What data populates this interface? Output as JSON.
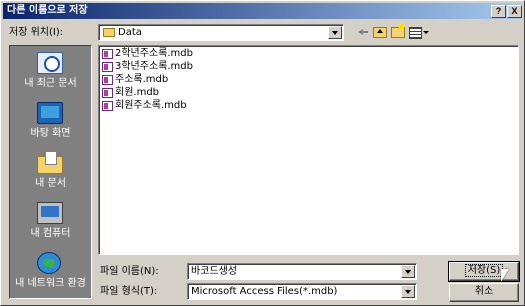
{
  "window": {
    "title": "다른 이름으로 저장",
    "help_button": "?",
    "close_button": "X"
  },
  "location": {
    "label": "저장 위치(I):",
    "value": "Data",
    "icon": "folder-icon"
  },
  "toolbar": {
    "icons": [
      "back-icon",
      "up-folder-icon",
      "new-folder-icon",
      "views-menu-icon"
    ]
  },
  "places": [
    {
      "label": "내 최근 문서",
      "icon": "recent-documents-icon"
    },
    {
      "label": "바탕 화면",
      "icon": "desktop-icon"
    },
    {
      "label": "내 문서",
      "icon": "my-documents-icon"
    },
    {
      "label": "내 컴퓨터",
      "icon": "my-computer-icon"
    },
    {
      "label": "내 네트워크 환경",
      "icon": "network-places-icon"
    }
  ],
  "files": [
    {
      "name": "2학년주소록.mdb"
    },
    {
      "name": "3학년주소록.mdb"
    },
    {
      "name": "주소록.mdb"
    },
    {
      "name": "회원.mdb"
    },
    {
      "name": "회원주소록.mdb"
    }
  ],
  "file_name": {
    "label": "파일 이름(N):",
    "value": "바코드생성"
  },
  "file_type": {
    "label": "파일 형식(T):",
    "value": "Microsoft Access Files(*.mdb)"
  },
  "buttons": {
    "save": "저장(S)",
    "cancel": "취소"
  },
  "colors": {
    "title_bar": "#0a246a",
    "dialog_bg": "#d4d0c8",
    "places_bg": "#808080"
  }
}
